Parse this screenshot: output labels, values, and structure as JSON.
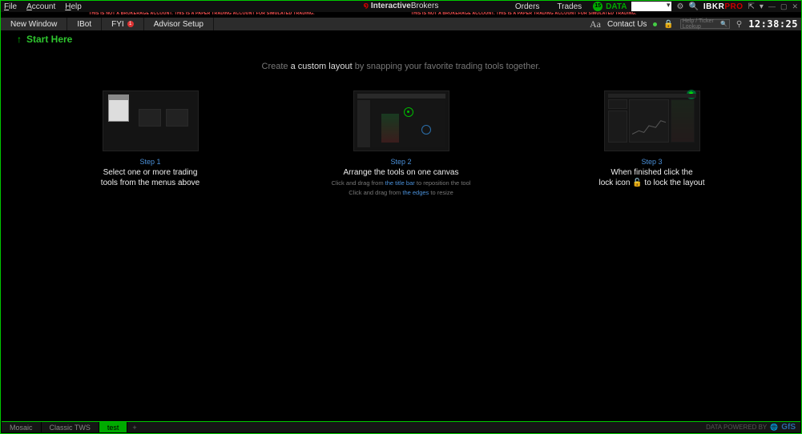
{
  "menubar": {
    "file": "File",
    "account": "Account",
    "help": "Help",
    "orders": "Orders",
    "trades": "Trades",
    "data_dot": "15",
    "data_label": "DATA"
  },
  "brand": {
    "name_a": "Interactive",
    "name_b": "Brokers"
  },
  "ibkr": {
    "white": "IBKR",
    "red": "PRO"
  },
  "disclaimer_text": "THIS IS NOT A BROKERAGE ACCOUNT. THIS IS A PAPER TRADING ACCOUNT FOR SIMULATED TRADING.",
  "toolbar": {
    "new_window": "New Window",
    "ibot": "IBot",
    "fyi": "FYI",
    "fyi_count": "1",
    "advisor_setup": "Advisor Setup",
    "font_icon": "Aa",
    "contact": "Contact Us",
    "ticker_ph": "Help / Ticker Lookup",
    "clock": "12:38:25"
  },
  "start_here": "Start Here",
  "headline": {
    "pre": "Create ",
    "em": "a custom layout",
    "post": " by snapping your favorite trading tools together."
  },
  "steps": {
    "s1": {
      "label": "Step 1",
      "line1": "Select one or more trading",
      "line2": "tools from the menus above"
    },
    "s2": {
      "label": "Step 2",
      "title": "Arrange the tools on one canvas",
      "sub1a": "Click and drag from ",
      "sub1b": "the title bar",
      "sub1c": " to reposition the tool",
      "sub2a": "Click and drag from ",
      "sub2b": "the edges",
      "sub2c": " to resize"
    },
    "s3": {
      "label": "Step 3",
      "line1": "When finished click the",
      "line2a": "lock icon ",
      "line2b": " to lock the layout"
    }
  },
  "footer": {
    "tabs": [
      {
        "label": "Mosaic",
        "active": false
      },
      {
        "label": "Classic TWS",
        "active": false
      },
      {
        "label": "test",
        "active": true
      }
    ],
    "add": "+",
    "credit_pre": "DATA POWERED BY",
    "credit_logo": "GfS"
  }
}
